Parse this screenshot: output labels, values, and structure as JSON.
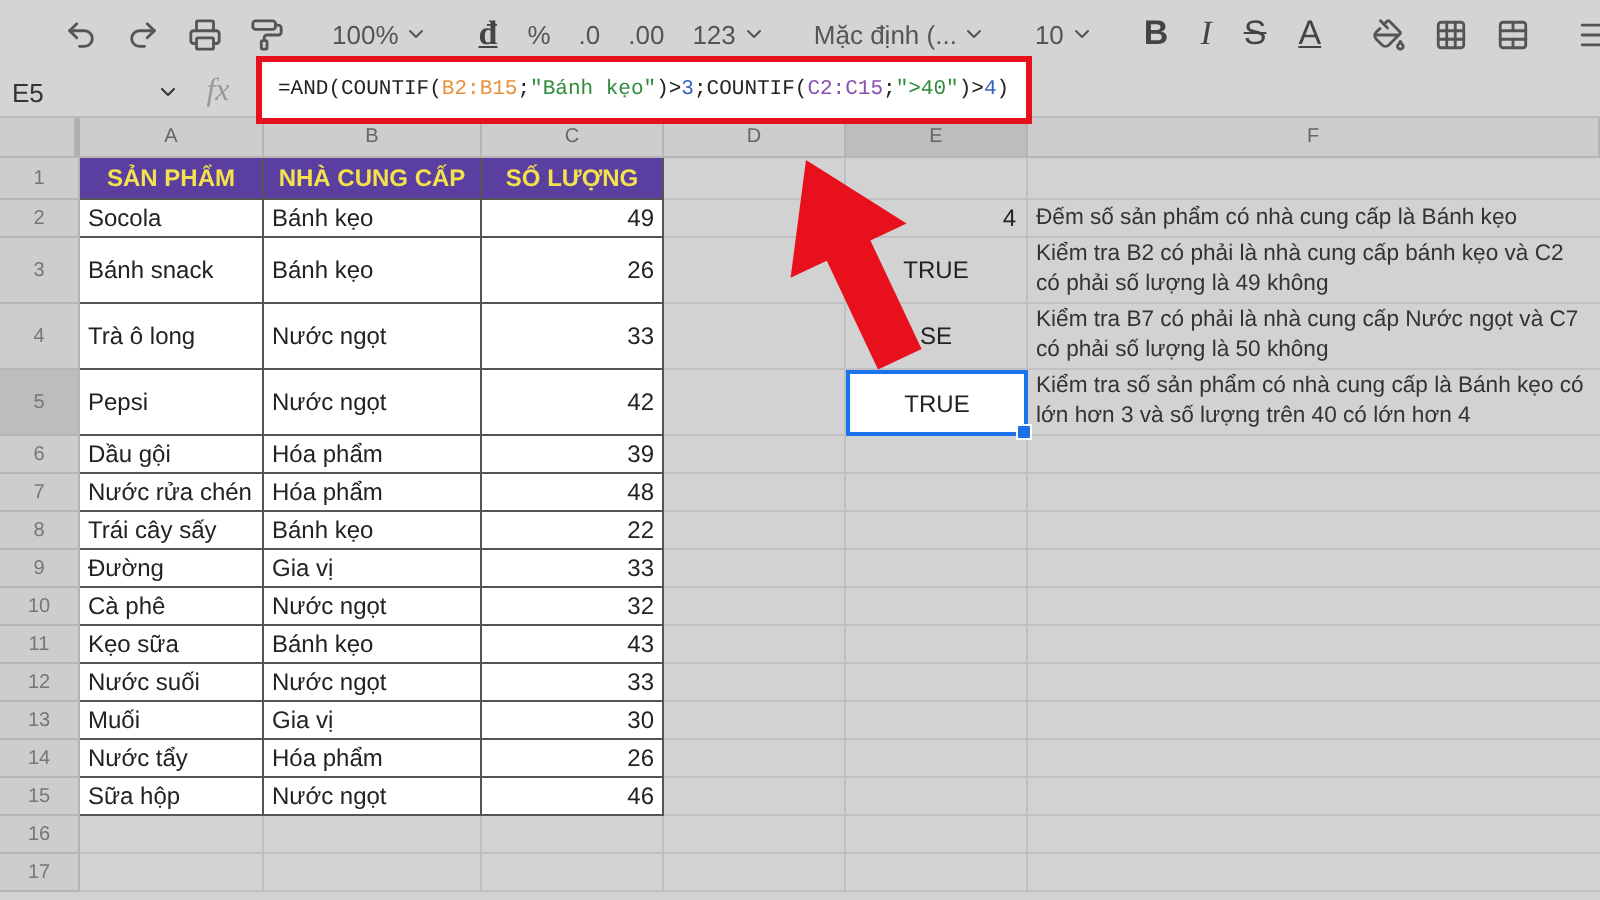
{
  "toolbar": {
    "zoom": "100%",
    "currency": "đ",
    "percent": "%",
    "decrease_decimal": ".0",
    "increase_decimal": ".00",
    "number_format": "123",
    "font": "Mặc định (...",
    "font_size": "10",
    "bold": "B",
    "italic": "I",
    "strikethrough": "S",
    "text_color": "A"
  },
  "formula_bar": {
    "cell_ref": "E5",
    "fx": "fx",
    "formula": [
      {
        "text": "=AND(COUNTIF(",
        "color": "#222222"
      },
      {
        "text": "B2:B15",
        "color": "#e8913a"
      },
      {
        "text": ";",
        "color": "#222222"
      },
      {
        "text": "\"Bánh kẹo\"",
        "color": "#2e8b3a"
      },
      {
        "text": ")>",
        "color": "#222222"
      },
      {
        "text": "3",
        "color": "#2f5fbf"
      },
      {
        "text": ";COUNTIF(",
        "color": "#222222"
      },
      {
        "text": "C2:C15",
        "color": "#8a4fb0"
      },
      {
        "text": ";",
        "color": "#222222"
      },
      {
        "text": "\">40\"",
        "color": "#2e8b3a"
      },
      {
        "text": ")>",
        "color": "#222222"
      },
      {
        "text": "4",
        "color": "#2f5fbf"
      },
      {
        "text": ")",
        "color": "#222222"
      }
    ]
  },
  "columns": [
    {
      "label": "A",
      "selected": false
    },
    {
      "label": "B",
      "selected": false
    },
    {
      "label": "C",
      "selected": false
    },
    {
      "label": "D",
      "selected": false
    },
    {
      "label": "E",
      "selected": true
    },
    {
      "label": "F",
      "selected": false
    }
  ],
  "rows": [
    {
      "kind": "header",
      "number": "1",
      "selected": false,
      "product": "SẢN PHẨM",
      "supplier": "NHÀ CUNG CẤP",
      "quantity": "SỐ LƯỢNG"
    },
    {
      "kind": "data",
      "number": "2",
      "selected": false,
      "product": "Socola",
      "supplier": "Bánh kẹo",
      "quantity": "49",
      "result": "4",
      "note": "Đếm số sản phẩm có nhà cung cấp là Bánh kẹo"
    },
    {
      "kind": "data",
      "number": "3",
      "selected": false,
      "product": "Bánh snack",
      "supplier": "Bánh kẹo",
      "quantity": "26",
      "result": "TRUE",
      "note": "Kiểm tra B2 có phải là nhà cung cấp bánh kẹo và C2 có phải số lượng là 49 không"
    },
    {
      "kind": "data",
      "number": "4",
      "selected": false,
      "product": "Trà ô long",
      "supplier": "Nước ngọt",
      "quantity": "33",
      "result": "SE",
      "note": "Kiểm tra B7 có phải là nhà cung cấp Nước ngọt và C7 có phải số lượng là 50 không"
    },
    {
      "kind": "data",
      "number": "5",
      "selected": true,
      "product": "Pepsi",
      "supplier": "Nước ngọt",
      "quantity": "42",
      "result": "TRUE",
      "note": "Kiểm tra số sản phẩm có nhà cung cấp là Bánh kẹo có lớn hơn 3 và số lượng trên 40 có lớn hơn 4"
    },
    {
      "kind": "data",
      "number": "6",
      "selected": false,
      "product": "Dầu gội",
      "supplier": "Hóa phẩm",
      "quantity": "39"
    },
    {
      "kind": "data",
      "number": "7",
      "selected": false,
      "product": "Nước rửa chén",
      "supplier": "Hóa phẩm",
      "quantity": "48"
    },
    {
      "kind": "data",
      "number": "8",
      "selected": false,
      "product": "Trái cây sấy",
      "supplier": "Bánh kẹo",
      "quantity": "22"
    },
    {
      "kind": "data",
      "number": "9",
      "selected": false,
      "product": "Đường",
      "supplier": "Gia vị",
      "quantity": "33"
    },
    {
      "kind": "data",
      "number": "10",
      "selected": false,
      "product": "Cà phê",
      "supplier": "Nước ngọt",
      "quantity": "32"
    },
    {
      "kind": "data",
      "number": "11",
      "selected": false,
      "product": "Kẹo sữa",
      "supplier": "Bánh kẹo",
      "quantity": "43"
    },
    {
      "kind": "data",
      "number": "12",
      "selected": false,
      "product": "Nước suối",
      "supplier": "Nước ngọt",
      "quantity": "33"
    },
    {
      "kind": "data",
      "number": "13",
      "selected": false,
      "product": "Muối",
      "supplier": "Gia vị",
      "quantity": "30"
    },
    {
      "kind": "data",
      "number": "14",
      "selected": false,
      "product": "Nước tẩy",
      "supplier": "Hóa phẩm",
      "quantity": "26"
    },
    {
      "kind": "data",
      "number": "15",
      "selected": false,
      "product": "Sữa hộp",
      "supplier": "Nước ngọt",
      "quantity": "46"
    },
    {
      "kind": "empty",
      "number": "16",
      "selected": false
    },
    {
      "kind": "empty",
      "number": "17",
      "selected": false
    }
  ]
}
